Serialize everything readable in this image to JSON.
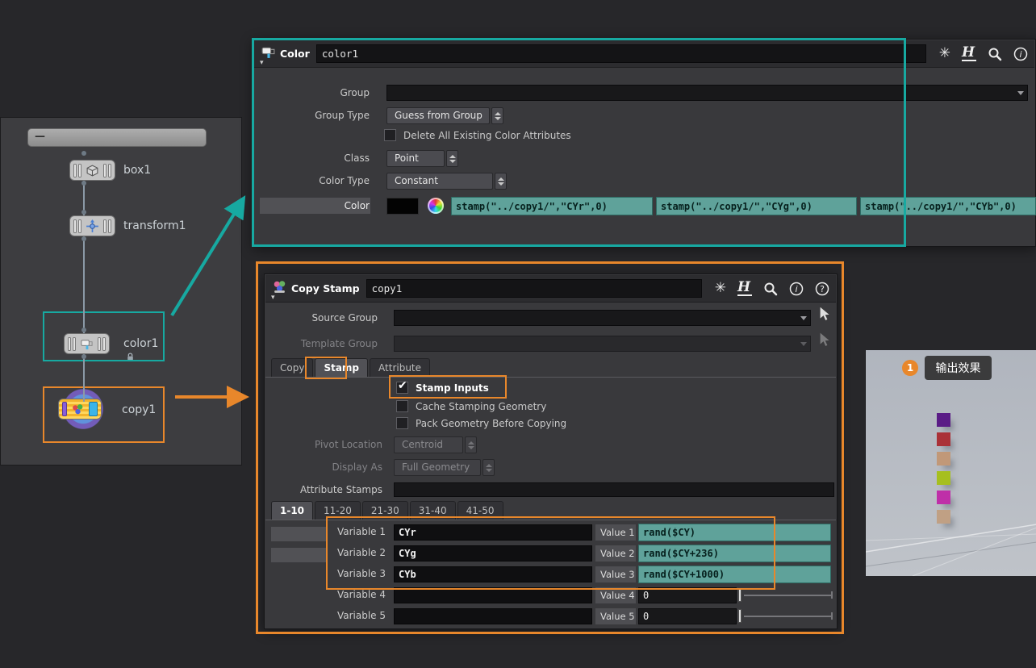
{
  "icons": {
    "gear": "✳",
    "check": "✔",
    "caret_down": "▾",
    "minus_collapse": "—",
    "h_logo": "H"
  },
  "accents": {
    "teal": "#17a9a1",
    "orange": "#e8872b"
  },
  "network": {
    "nodes": {
      "box": {
        "label": "box1"
      },
      "transform": {
        "label": "transform1"
      },
      "color": {
        "label": "color1"
      },
      "copy": {
        "label": "copy1"
      }
    }
  },
  "color_panel": {
    "type_label": "Color",
    "name_value": "color1",
    "group_label": "Group",
    "group_value": "",
    "group_type_label": "Group Type",
    "group_type_value": "Guess from Group",
    "delete_existing_label": "Delete All Existing Color Attributes",
    "class_label": "Class",
    "class_value": "Point",
    "color_type_label": "Color Type",
    "color_type_value": "Constant",
    "color_label": "Color",
    "expr_r": "stamp(\"../copy1/\",\"CYr\",0)",
    "expr_g": "stamp(\"../copy1/\",\"CYg\",0)",
    "expr_b": "stamp(\"../copy1/\",\"CYb\",0)",
    "expr_field_bg": "#5fa29a"
  },
  "copy_panel": {
    "type_label": "Copy Stamp",
    "name_value": "copy1",
    "source_group_label": "Source Group",
    "source_group_value": "",
    "template_group_label": "Template Group",
    "template_group_value": "",
    "tabs": [
      "Copy",
      "Stamp",
      "Attribute"
    ],
    "active_tab": "Stamp",
    "stamp_inputs_label": "Stamp Inputs",
    "cache_label": "Cache Stamping Geometry",
    "pack_label": "Pack Geometry Before Copying",
    "pivot_label": "Pivot Location",
    "pivot_value": "Centroid",
    "display_as_label": "Display As",
    "display_as_value": "Full Geometry",
    "attribute_stamps_label": "Attribute Stamps",
    "attribute_stamps_value": "",
    "range_tabs": [
      "1-10",
      "11-20",
      "21-30",
      "31-40",
      "41-50"
    ],
    "active_range_tab": "1-10",
    "variables": [
      {
        "label": "Variable 1",
        "name": "CYr",
        "value_label": "Value 1",
        "value": "rand($CY)"
      },
      {
        "label": "Variable 2",
        "name": "CYg",
        "value_label": "Value 2",
        "value": "rand($CY+236)"
      },
      {
        "label": "Variable 3",
        "name": "CYb",
        "value_label": "Value 3",
        "value": "rand($CY+1000)"
      },
      {
        "label": "Variable 4",
        "name": "",
        "value_label": "Value 4",
        "value": "0"
      },
      {
        "label": "Variable 5",
        "name": "",
        "value_label": "Value 5",
        "value": "0"
      }
    ]
  },
  "viewport": {
    "badge": "1",
    "caption": "输出效果",
    "swatches": [
      "#5a1c86",
      "#aa3137",
      "#c19878",
      "#a6bf1e",
      "#bf2fa8",
      "#c0a084"
    ]
  }
}
